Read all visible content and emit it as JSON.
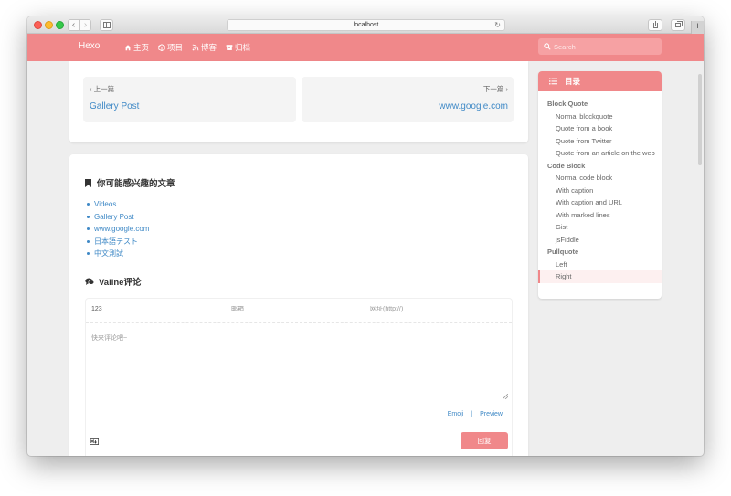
{
  "browser": {
    "url": "localhost",
    "back_icon": "chevron-left-icon",
    "forward_icon": "chevron-right-icon",
    "new_tab": "+"
  },
  "site": {
    "brand": "Hexo",
    "accent_color": "#f0888a",
    "link_color": "#3f89c6",
    "menu": [
      {
        "label": "主页",
        "icon": "home-icon"
      },
      {
        "label": "项目",
        "icon": "box-icon"
      },
      {
        "label": "博客",
        "icon": "rss-icon"
      },
      {
        "label": "归档",
        "icon": "archive-icon"
      }
    ],
    "search_placeholder": "Search"
  },
  "post_nav": {
    "prev_label": "上一篇",
    "prev_title": "Gallery Post",
    "next_label": "下一篇",
    "next_title": "www.google.com"
  },
  "related": {
    "title": "你可能感兴趣的文章",
    "items": [
      "Videos",
      "Gallery Post",
      "www.google.com",
      "日本語テスト",
      "中文測試"
    ]
  },
  "comments": {
    "title": "Valine评论",
    "name_value": "123",
    "mail_placeholder": "邮箱",
    "url_placeholder": "网址(http://)",
    "text_placeholder": "快来评论吧~",
    "emoji_label": "Emoji",
    "separator": "|",
    "preview_label": "Preview",
    "reply_label": "回复"
  },
  "toc": {
    "title": "目录",
    "items": [
      {
        "label": "Block Quote",
        "level": 1
      },
      {
        "label": "Normal blockquote",
        "level": 2
      },
      {
        "label": "Quote from a book",
        "level": 2
      },
      {
        "label": "Quote from Twitter",
        "level": 2
      },
      {
        "label": "Quote from an article on the web",
        "level": 2
      },
      {
        "label": "Code Block",
        "level": 1
      },
      {
        "label": "Normal code block",
        "level": 2
      },
      {
        "label": "With caption",
        "level": 2
      },
      {
        "label": "With caption and URL",
        "level": 2
      },
      {
        "label": "With marked lines",
        "level": 2
      },
      {
        "label": "Gist",
        "level": 2
      },
      {
        "label": "jsFiddle",
        "level": 2
      },
      {
        "label": "Pullquote",
        "level": 1
      },
      {
        "label": "Left",
        "level": 2
      },
      {
        "label": "Right",
        "level": 2,
        "active": true
      }
    ]
  }
}
